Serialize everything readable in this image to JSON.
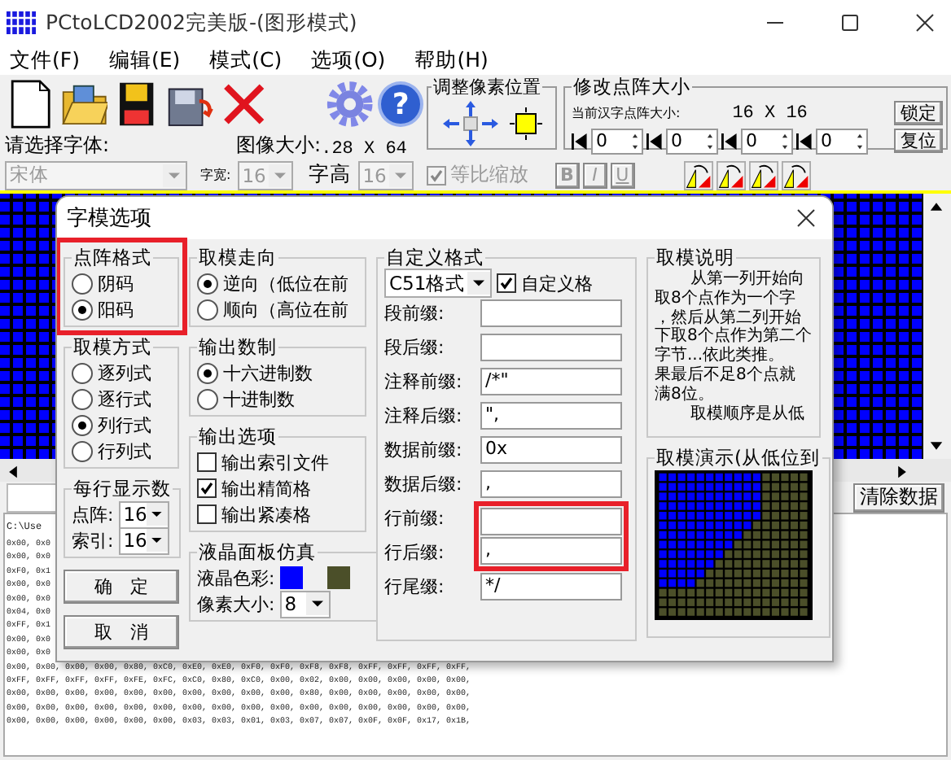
{
  "window": {
    "title": "PCtoLCD2002完美版-(图形模式)"
  },
  "menu": [
    "文件(F)",
    "编辑(E)",
    "模式(C)",
    "选项(O)",
    "帮助(H)"
  ],
  "toolbar": {
    "help_glyph": "?",
    "adjust_pixel_position": {
      "title": "调整像素位置"
    },
    "matrix_size": {
      "title": "修改点阵大小",
      "current_label": "当前汉字点阵大小:",
      "current_value": "16 X 16",
      "lock_button": "锁定",
      "reset_button": "复位",
      "spinners": [
        "0",
        "0",
        "0",
        "0"
      ]
    },
    "font_label": "请选择字体:",
    "image_size_label": "图像大小:",
    "image_size_value": ".28 X 64",
    "font": {
      "value": "宋体",
      "disabled": true
    },
    "width_label": "字宽:",
    "width": {
      "value": "16",
      "disabled": true
    },
    "height_label": "字高",
    "height": {
      "value": "16",
      "disabled": true
    },
    "proportional": {
      "label": "等比缩放",
      "checked": true,
      "disabled": true
    },
    "style_buttons": [
      {
        "kind": "bold",
        "label": "B",
        "disabled": true
      },
      {
        "kind": "italic",
        "label": "I",
        "disabled": true
      },
      {
        "kind": "underline",
        "label": "U",
        "disabled": true
      }
    ]
  },
  "clear_button": "清除数据",
  "data_panel": {
    "path": "C:\\Use",
    "partial_lines": [
      "0x00, 0x0",
      "0x00, 0x0",
      "0xF0, 0x1",
      "0x00, 0x0",
      "0x00, 0x0",
      "0x04, 0x0",
      "0xFF, 0x1",
      "0x00, 0x0",
      "0x00, 0x0"
    ],
    "lines": [
      "0x00, 0x00, 0x00, 0x00, 0x80, 0xC0, 0xE0, 0xE0, 0xF0, 0xF0, 0xF8, 0xF8, 0xFF, 0xFF, 0xFF, 0xFF,",
      "0xFF, 0xFF, 0xFF, 0xFF, 0xFE, 0xFC, 0xC0, 0x80, 0xC0, 0x00, 0x02, 0x00, 0x00, 0x00, 0x00, 0x00,",
      "0x00, 0x00, 0x00, 0x00, 0x00, 0x00, 0x00, 0x00, 0x00, 0x00, 0x80, 0x00, 0x00, 0x00, 0x00, 0x00,",
      "0x00, 0x00, 0x00, 0x00, 0x00, 0x00, 0x00, 0x00, 0x00, 0x00, 0x00, 0x00, 0x00, 0x00, 0x00, 0x00,",
      "0x00, 0x00, 0x00, 0x00, 0x00, 0x00, 0x03, 0x03, 0x01, 0x03, 0x07, 0x07, 0x0F, 0x0F, 0x17, 0x1B,"
    ]
  },
  "dialog": {
    "title": "字模选项",
    "dot_format": {
      "title": "点阵格式",
      "highlighted": true,
      "options": [
        {
          "label": "阴码",
          "selected": false
        },
        {
          "label": "阳码",
          "selected": true
        }
      ]
    },
    "mode": {
      "title": "取模方式",
      "options": [
        {
          "label": "逐列式",
          "selected": false
        },
        {
          "label": "逐行式",
          "selected": false
        },
        {
          "label": "列行式",
          "selected": true
        },
        {
          "label": "行列式",
          "selected": false
        }
      ]
    },
    "per_line": {
      "title": "每行显示数",
      "fields": [
        {
          "label": "点阵:",
          "value": "16"
        },
        {
          "label": "索引:",
          "value": "16"
        }
      ]
    },
    "buttons": [
      "确　定",
      "取　消"
    ],
    "direction": {
      "title": "取模走向",
      "options": [
        {
          "label": "逆向（低位在前",
          "selected": true
        },
        {
          "label": "顺向（高位在前",
          "selected": false
        }
      ]
    },
    "number_base": {
      "title": "输出数制",
      "options": [
        {
          "label": "十六进制数",
          "selected": true
        },
        {
          "label": "十进制数",
          "selected": false
        }
      ]
    },
    "output_options": {
      "title": "输出选项",
      "options": [
        {
          "label": "输出索引文件",
          "checked": false
        },
        {
          "label": "输出精简格",
          "checked": true
        },
        {
          "label": "输出紧凑格",
          "checked": false
        }
      ]
    },
    "lcd": {
      "title": "液晶面板仿真",
      "color_label": "液晶色彩:",
      "colors": [
        {
          "color": "#0000ff"
        },
        {
          "color": "#4b4f29"
        }
      ],
      "pixel_size_label": "像素大小:",
      "pixel_size": "8"
    },
    "custom": {
      "title": "自定义格式",
      "preset": "C51格式",
      "enabled": {
        "label": "自定义格",
        "checked": true
      },
      "fields": [
        {
          "label": "段前缀:",
          "highlighted": false
        },
        {
          "label": "段后缀:",
          "highlighted": false
        },
        {
          "label": "注释前缀:",
          "value": "/*\"",
          "highlighted": false
        },
        {
          "label": "注释后缀:",
          "value": "\",",
          "highlighted": false
        },
        {
          "label": "数据前缀:",
          "value": "0x",
          "highlighted": false
        },
        {
          "label": "数据后缀:",
          "value": ",",
          "highlighted": false
        },
        {
          "label": "行前缀:",
          "highlighted": true
        },
        {
          "label": "行后缀:",
          "value": ",",
          "highlighted": true
        },
        {
          "label": "行尾缀:",
          "value": "*/",
          "highlighted": false
        }
      ]
    },
    "explanation": {
      "title": "取模说明",
      "lines": [
        {
          "text": "从第一列开始向",
          "indent": true
        },
        {
          "text": "取8个点作为一个字",
          "indent": false
        },
        {
          "text": "，然后从第二列开始",
          "indent": false
        },
        {
          "text": "下取8个点作为第二个",
          "indent": false
        },
        {
          "text": "字节...依此类推。",
          "indent": false
        },
        {
          "text": "果最后不足8个点就",
          "indent": false
        },
        {
          "text": "满8位。",
          "indent": false
        },
        {
          "text": "取模顺序是从低",
          "indent": true
        }
      ]
    },
    "demo": {
      "title": "取模演示(从低位到"
    }
  }
}
